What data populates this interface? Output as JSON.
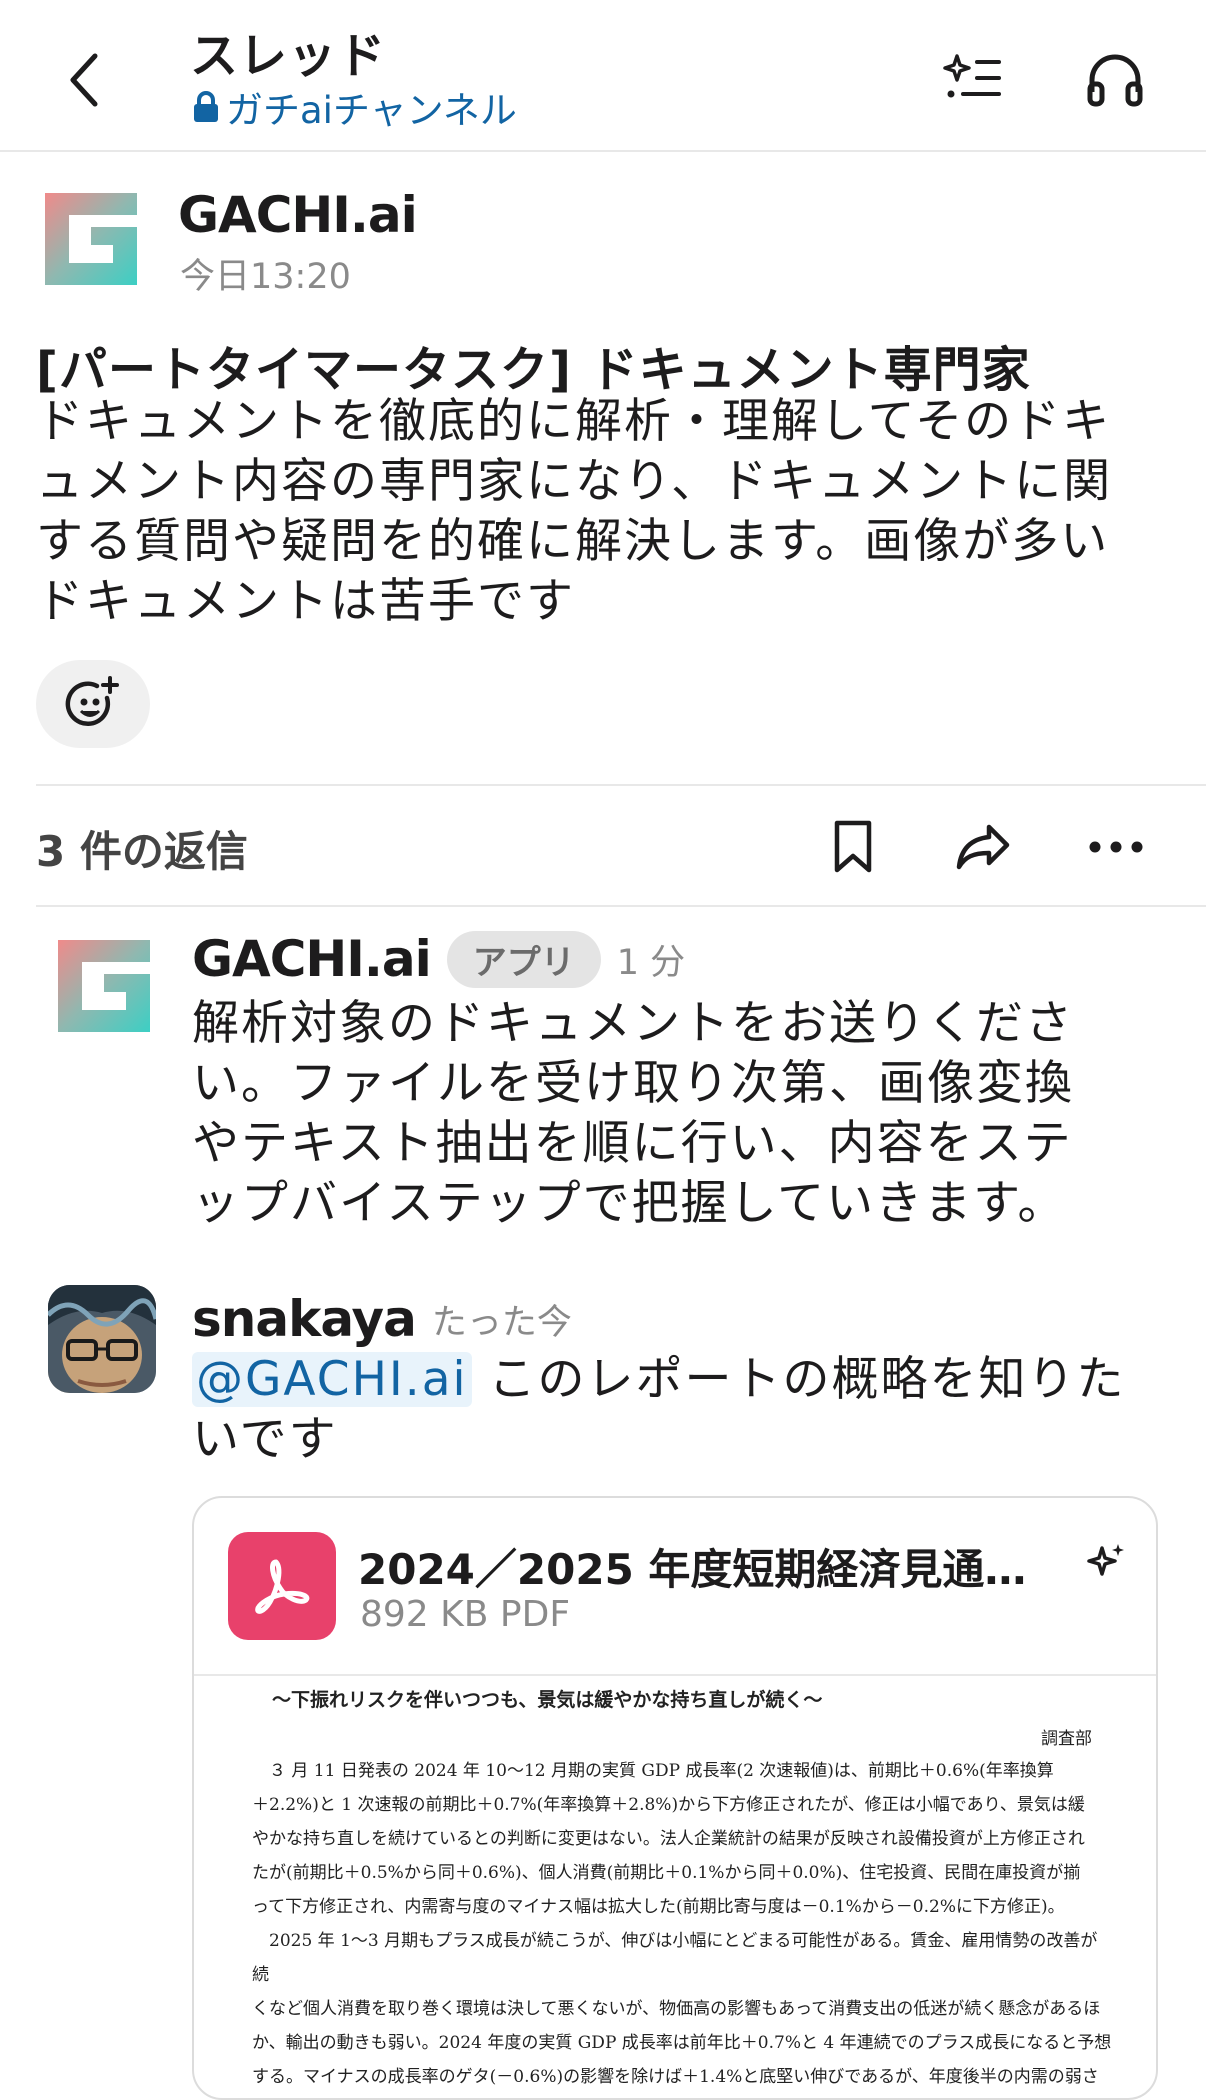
{
  "header": {
    "title": "スレッド",
    "channel": "ガチaiチャンネル"
  },
  "parent": {
    "author": "GACHI.ai",
    "time": "今日13:20",
    "title": "[パートタイマータスク] ドキュメント専門家",
    "lines": [
      "ドキュメントを徹底的に解析・理解してそのドキ",
      "ュメント内容の専門家になり、ドキュメントに関",
      "する質問や疑問を的確に解決します。画像が多い",
      "ドキュメントは苦手です"
    ]
  },
  "replies_bar": {
    "count_label": "3 件の返信"
  },
  "reply1": {
    "author": "GACHI.ai",
    "badge": "アプリ",
    "time": "1 分",
    "lines": [
      "解析対象のドキュメントをお送りくださ",
      "い。ファイルを受け取り次第、画像変換",
      "やテキスト抽出を順に行い、内容をステ",
      "ップバイステップで把握していきます。"
    ]
  },
  "reply2": {
    "author": "snakaya",
    "time": "たった今",
    "mention": "@GACHI.ai",
    "line1_rest": " このレポートの概略を知りた",
    "line2": "いです"
  },
  "attachment": {
    "filename": "2024／2025 年度短期経済見通…",
    "meta": "892 KB PDF",
    "preview": {
      "subtitle": "～下振れリスクを伴いつつも、景気は緩やかな持ち直しが続く～",
      "dept": "調査部",
      "lines": [
        "　３ 月 11 日発表の 2024 年 10～12 月期の実質 GDP 成長率(2 次速報値)は、前期比＋0.6%(年率換算",
        "＋2.2%)と 1 次速報の前期比＋0.7%(年率換算＋2.8%)から下方修正されたが、修正は小幅であり、景気は緩",
        "やかな持ち直しを続けているとの判断に変更はない。法人企業統計の結果が反映され設備投資が上方修正され",
        "たが(前期比＋0.5%から同＋0.6%)、個人消費(前期比＋0.1%から同＋0.0%)、住宅投資、民間在庫投資が揃",
        "って下方修正され、内需寄与度のマイナス幅は拡大した(前期比寄与度は－0.1%から－0.2%に下方修正)。",
        "　2025 年 1～3 月期もプラス成長が続こうが、伸びは小幅にとどまる可能性がある。賃金、雇用情勢の改善が続",
        "くなど個人消費を取り巻く環境は決して悪くないが、物価高の影響もあって消費支出の低迷が続く懸念があるほ",
        "か、輸出の動きも弱い。2024 年度の実質 GDP 成長率は前年比＋0.7%と 4 年連続でのプラス成長になると予想",
        "する。マイナスの成長率のゲタ(－0.6%)の影響を除けば＋1.4%と底堅い伸びであるが、年度後半の内需の弱さ"
      ]
    }
  },
  "colors": {
    "link": "#1264a3",
    "pdf_icon": "#e8416b",
    "logo_start": "#f08a8a",
    "logo_end": "#3ccfc4"
  }
}
